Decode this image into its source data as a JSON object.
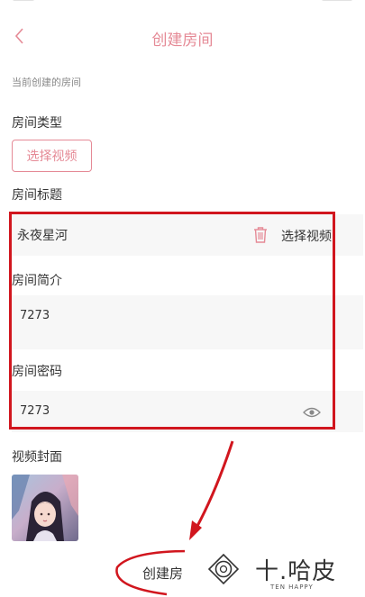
{
  "header": {
    "title": "创建房间"
  },
  "section_caption": "当前创建的房间",
  "room_type": {
    "label": "房间类型",
    "button_label": "选择视频"
  },
  "room_title": {
    "label": "房间标题",
    "value": "永夜星河",
    "select_label": "选择视频"
  },
  "room_intro": {
    "label": "房间简介",
    "value": "7273"
  },
  "room_password": {
    "label": "房间密码",
    "value": "7273"
  },
  "video_cover": {
    "label": "视频封面"
  },
  "create_button_label": "创建房",
  "watermark": {
    "name": "十.哈皮",
    "sub": "TEN HAPPY"
  },
  "colors": {
    "accent": "#e58a96",
    "annotation": "#d1161e"
  },
  "icons": [
    "chevron-left-icon",
    "trash-icon",
    "eye-icon",
    "logo-icon"
  ]
}
